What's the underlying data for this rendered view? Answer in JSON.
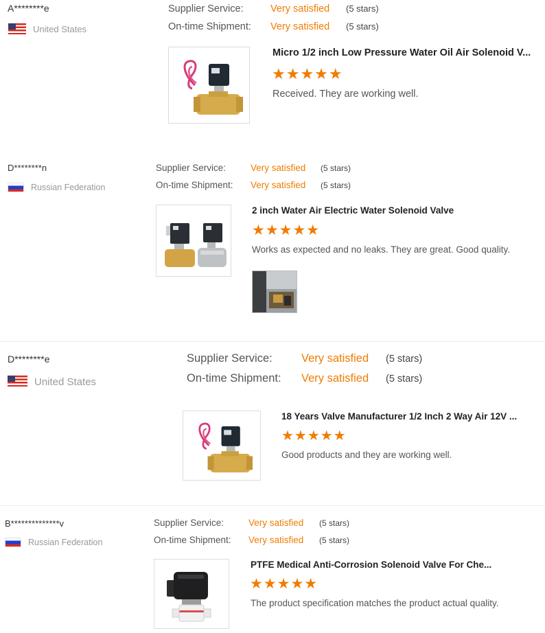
{
  "accent_color": "#f07c00",
  "labels": {
    "supplier_service": "Supplier Service:",
    "ontime_shipment": "On-time Shipment:"
  },
  "reviews": [
    {
      "reviewer": "A********e",
      "country": "United States",
      "flag": "us-flag-icon",
      "supplier_service": "Very satisfied",
      "supplier_stars": "(5 stars)",
      "shipment": "Very satisfied",
      "shipment_stars": "(5 stars)",
      "product_title": "Micro 1/2 inch Low Pressure Water Oil Air Solenoid V...",
      "rating": 5,
      "stars": "★★★★★",
      "comment": "Received. They are working well."
    },
    {
      "reviewer": "D********n",
      "country": "Russian Federation",
      "flag": "ru-flag-icon",
      "supplier_service": "Very satisfied",
      "supplier_stars": "(5 stars)",
      "shipment": "Very satisfied",
      "shipment_stars": "(5 stars)",
      "product_title": "2 inch Water Air Electric Water Solenoid Valve",
      "rating": 5,
      "stars": "★★★★★",
      "comment": "Works as expected and no leaks. They are great. Good quality."
    },
    {
      "reviewer": "D********e",
      "country": "United States",
      "flag": "us-flag-icon",
      "supplier_service": "Very satisfied",
      "supplier_stars": "(5 stars)",
      "shipment": "Very satisfied",
      "shipment_stars": "(5 stars)",
      "product_title": "18 Years Valve Manufacturer 1/2 Inch 2 Way Air 12V ...",
      "rating": 5,
      "stars": "★★★★★",
      "comment": "Good products and they are working well."
    },
    {
      "reviewer": "B**************v",
      "country": "Russian Federation",
      "flag": "ru-flag-icon",
      "supplier_service": "Very satisfied",
      "supplier_stars": "(5 stars)",
      "shipment": "Very satisfied",
      "shipment_stars": "(5 stars)",
      "product_title": "PTFE Medical Anti-Corrosion Solenoid Valve For Che...",
      "rating": 5,
      "stars": "★★★★★",
      "comment": "The product specification matches the product actual quality."
    }
  ]
}
